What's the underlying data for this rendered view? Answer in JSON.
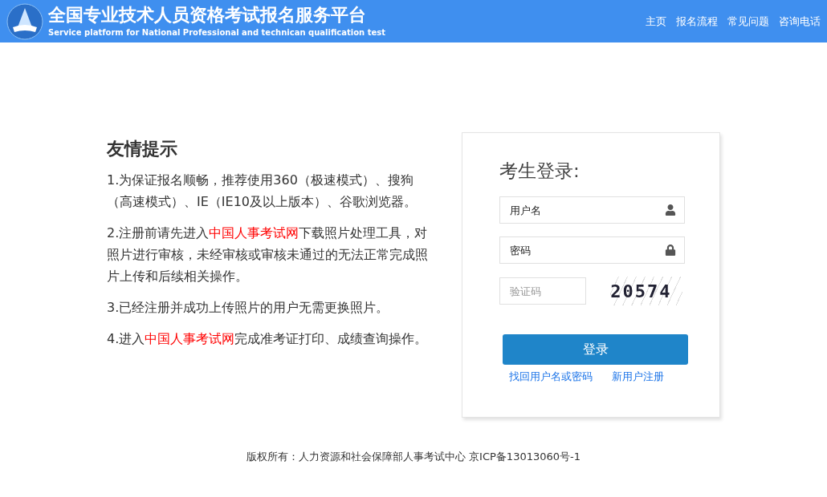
{
  "header": {
    "title": "全国专业技术人员资格考试报名服务平台",
    "subtitle": "Service platform for National Professional and technican qualification test",
    "nav": [
      "主页",
      "报名流程",
      "常见问题",
      "咨询电话"
    ]
  },
  "notice": {
    "title": "友情提示",
    "paragraphs": [
      [
        {
          "kind": "text",
          "text": "1.为保证报名顺畅，推荐使用360（极速模式）、搜狗（高速模式）、IE（IE10及以上版本）、谷歌浏览器。"
        }
      ],
      [
        {
          "kind": "text",
          "text": "2.注册前请先进入"
        },
        {
          "kind": "link",
          "text": "中国人事考试网"
        },
        {
          "kind": "text",
          "text": "下载照片处理工具，对照片进行审核，未经审核或审核未通过的无法正常完成照片上传和后续相关操作。"
        }
      ],
      [
        {
          "kind": "text",
          "text": "3.已经注册并成功上传照片的用户无需更换照片。"
        }
      ],
      [
        {
          "kind": "text",
          "text": "4.进入"
        },
        {
          "kind": "link",
          "text": "中国人事考试网"
        },
        {
          "kind": "text",
          "text": "完成准考证打印、成绩查询操作。"
        }
      ]
    ]
  },
  "login": {
    "title": "考生登录:",
    "fields": [
      {
        "kind": "username",
        "placeholder": "用户名"
      },
      {
        "kind": "password",
        "placeholder": "密码"
      },
      {
        "kind": "captcha",
        "placeholder": "验证码",
        "captcha": "20574"
      }
    ],
    "submit": "登录",
    "links": [
      "找回用户名或密码",
      "新用户注册"
    ]
  },
  "footer": "版权所有：人力资源和社会保障部人事考试中心 京ICP备13013060号-1"
}
